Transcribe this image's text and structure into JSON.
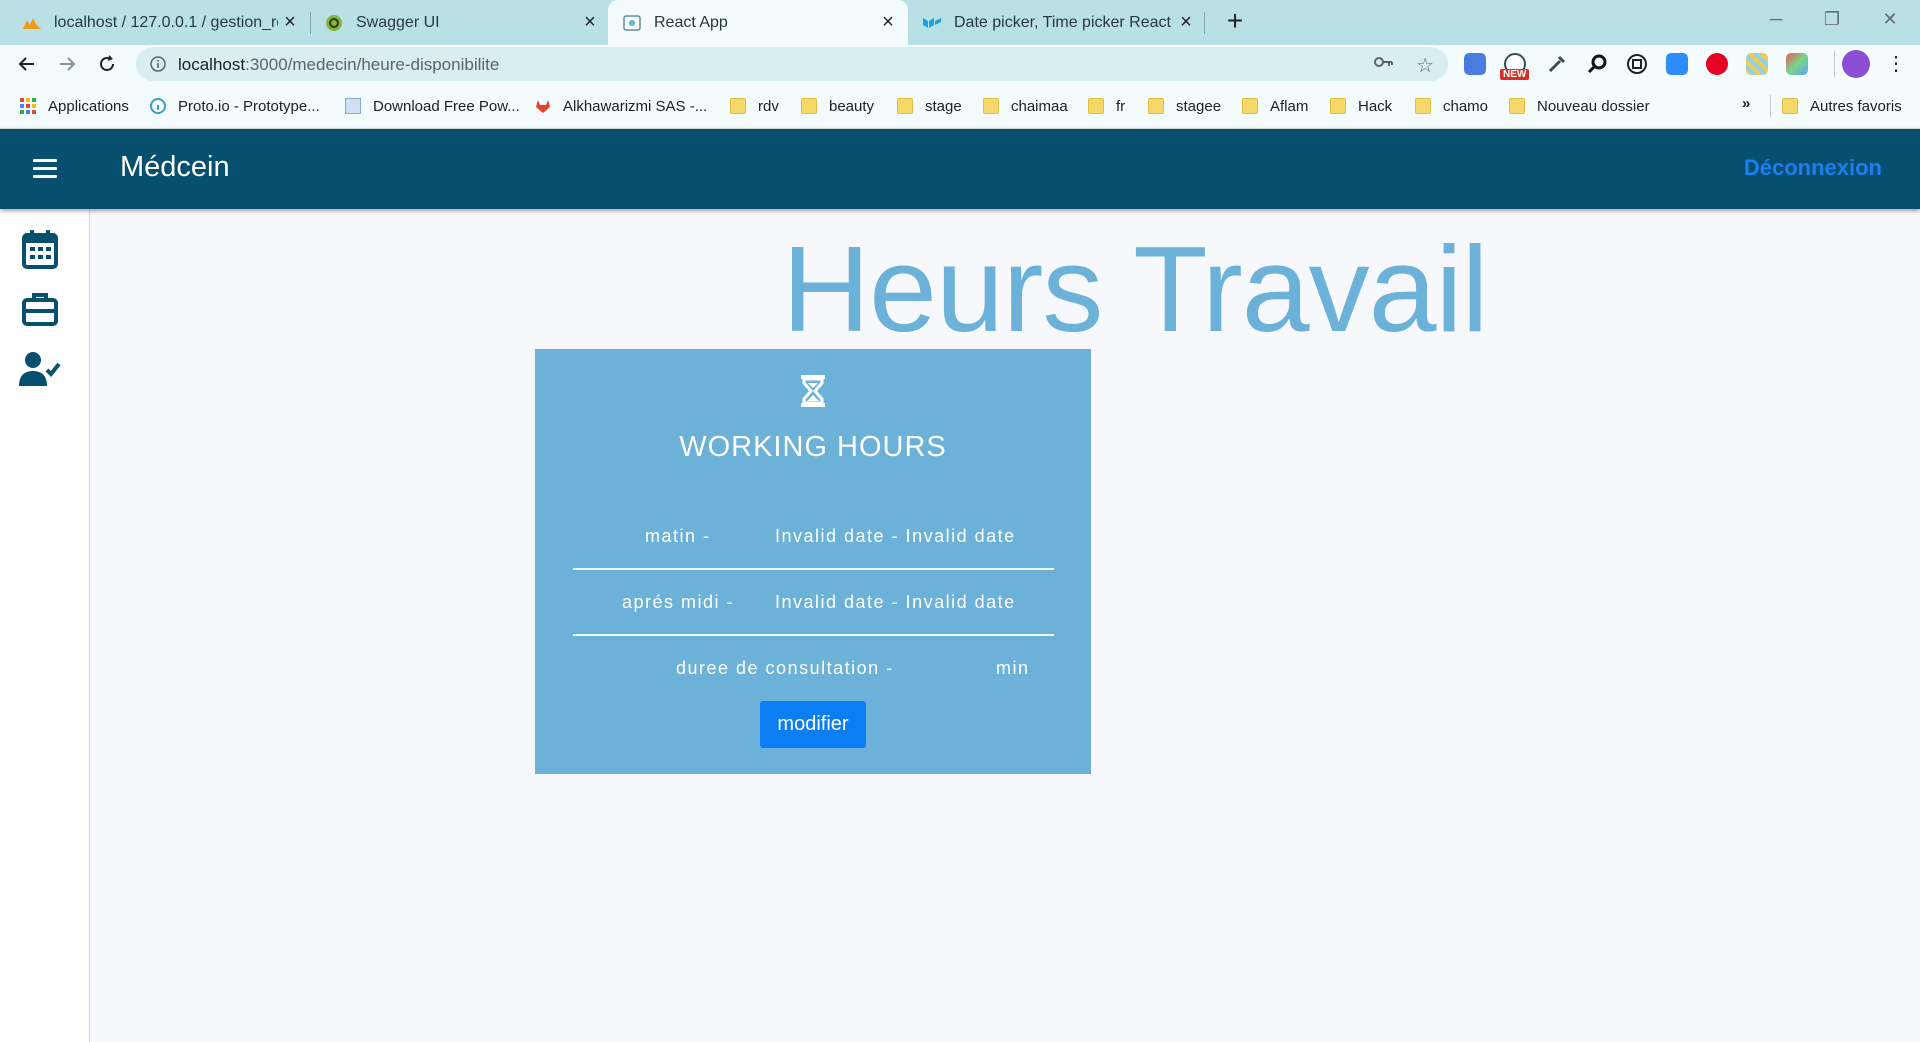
{
  "browser": {
    "tabs": [
      {
        "title": "localhost / 127.0.0.1 / gestion_rdv",
        "active": false
      },
      {
        "title": "Swagger UI",
        "active": false
      },
      {
        "title": "React App",
        "active": true
      },
      {
        "title": "Date picker, Time picker React co",
        "active": false
      }
    ],
    "url_host": "localhost",
    "url_path": ":3000/medecin/heure-disponibilite",
    "bookmarks": [
      {
        "label": "Applications",
        "icon": "apps-grid-icon"
      },
      {
        "label": "Proto.io - Prototype...",
        "icon": "protoio-icon"
      },
      {
        "label": "Download Free Pow...",
        "icon": "page-icon"
      },
      {
        "label": "Alkhawarizmi SAS -...",
        "icon": "gitlab-icon"
      },
      {
        "label": "rdv",
        "icon": "folder-icon"
      },
      {
        "label": "beauty",
        "icon": "folder-icon"
      },
      {
        "label": "stage",
        "icon": "folder-icon"
      },
      {
        "label": "chaimaa",
        "icon": "folder-icon"
      },
      {
        "label": "fr",
        "icon": "folder-icon"
      },
      {
        "label": "stagee",
        "icon": "folder-icon"
      },
      {
        "label": "Aflam",
        "icon": "folder-icon"
      },
      {
        "label": "Hack",
        "icon": "folder-icon"
      },
      {
        "label": "chamo",
        "icon": "folder-icon"
      },
      {
        "label": "Nouveau dossier",
        "icon": "folder-icon"
      }
    ],
    "bookmarks_more": "»",
    "other_bookmarks": "Autres favoris",
    "ext_badge": "NEW"
  },
  "app": {
    "title": "Médcein",
    "logout": "Déconnexion",
    "accent": "#1a7ff0",
    "bar_color": "#074f6f"
  },
  "sidebar": {
    "items": [
      {
        "name": "calendar-icon"
      },
      {
        "name": "briefcase-icon"
      },
      {
        "name": "user-check-icon"
      }
    ]
  },
  "page": {
    "heading": "Heurs Travail",
    "card": {
      "icon": "hourglass-icon",
      "title": "WORKING HOURS",
      "morning_label": "matin -",
      "morning_value": "Invalid date - Invalid date",
      "afternoon_label": "aprés midi -",
      "afternoon_value": "Invalid date - Invalid date",
      "consult_label": "duree de consultation -",
      "consult_unit": "min",
      "button": "modifier",
      "color": "#6bb1d8"
    }
  }
}
